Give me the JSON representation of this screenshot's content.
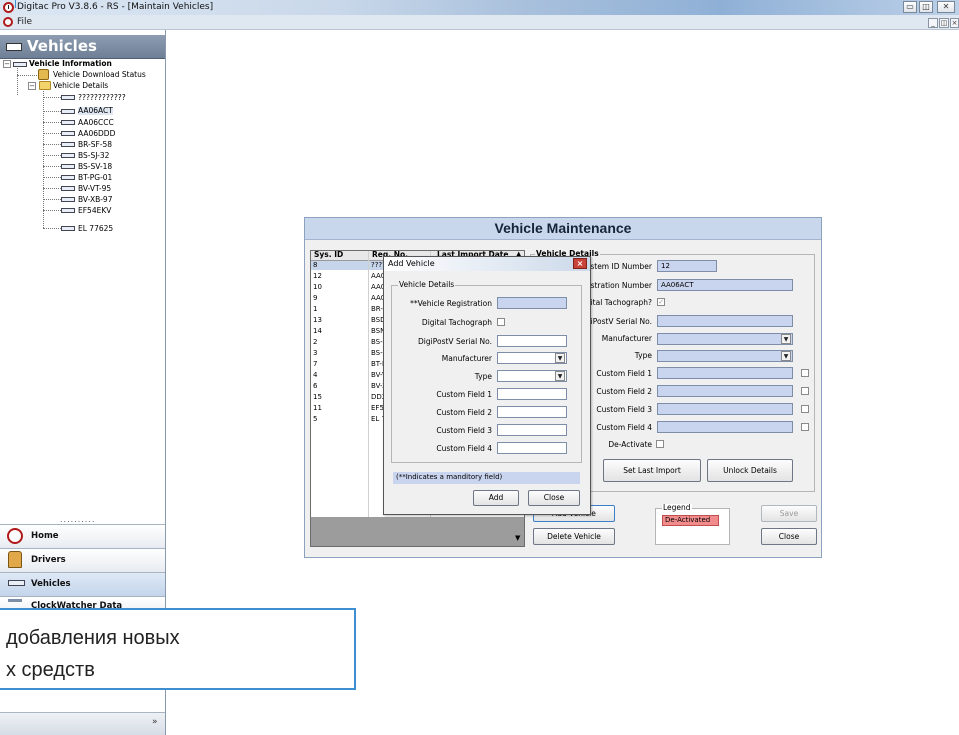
{
  "window": {
    "title": "Digitac Pro V3.8.6 - RS - [Maintain Vehicles]",
    "menu_file": "File"
  },
  "sidebar": {
    "header": "Vehicles",
    "tree": {
      "root": "Vehicle Information",
      "download_status": "Vehicle Download Status",
      "details": "Vehicle Details",
      "vehicles": [
        "????????????",
        "AA06ACT",
        "AA06CCC",
        "AA06DDD",
        "BR-SF-58",
        "BS-SJ-32",
        "BS-SV-18",
        "BT-PG-01",
        "BV-VT-95",
        "BV-XB-97",
        "EF54EKV",
        "EL 77625"
      ]
    },
    "splitter": "..........",
    "nav": [
      {
        "label": "Home",
        "icon": "clock-icon"
      },
      {
        "label": "Drivers",
        "icon": "driver-icon"
      },
      {
        "label": "Vehicles",
        "icon": "vehicle-icon"
      },
      {
        "label": "ClockWatcher Data",
        "icon": "clockwatcher-icon"
      }
    ],
    "more": "»"
  },
  "vm": {
    "title": "Vehicle Maintenance",
    "grid": {
      "columns": [
        "Sys. ID",
        "Reg. No.",
        "Last Import Date"
      ],
      "rows": [
        {
          "id": "8",
          "reg": "????"
        },
        {
          "id": "12",
          "reg": "AA06"
        },
        {
          "id": "10",
          "reg": "AA06"
        },
        {
          "id": "9",
          "reg": "AA06"
        },
        {
          "id": "1",
          "reg": "BR-SF"
        },
        {
          "id": "13",
          "reg": "BSDL"
        },
        {
          "id": "14",
          "reg": "BSNH"
        },
        {
          "id": "2",
          "reg": "BS-SJ"
        },
        {
          "id": "3",
          "reg": "BS-SV"
        },
        {
          "id": "7",
          "reg": "BT-PC"
        },
        {
          "id": "4",
          "reg": "BV-VT"
        },
        {
          "id": "6",
          "reg": "BV-XE"
        },
        {
          "id": "15",
          "reg": "DD20"
        },
        {
          "id": "11",
          "reg": "EF54E"
        },
        {
          "id": "5",
          "reg": "EL 77"
        }
      ]
    },
    "details": {
      "group_label": "Vehicle Details",
      "system_id_label": "System ID Number",
      "system_id_value": "12",
      "reg_label": "Registration Number",
      "reg_value": "AA06ACT",
      "digital_tacho_label": "Digital Tachograph?",
      "serial_label": "DigiPostV Serial No.",
      "manufacturer_label": "Manufacturer",
      "type_label": "Type",
      "custom1": "Custom Field 1",
      "custom2": "Custom Field 2",
      "custom3": "Custom Field 3",
      "custom4": "Custom Field 4",
      "deactivate_label": "De-Activate",
      "set_last_import": "Set Last Import",
      "unlock_details": "Unlock Details"
    },
    "legend": {
      "title": "Legend",
      "deactivated": "De-Activated"
    },
    "buttons": {
      "add_vehicle": "Add Vehicle",
      "delete_vehicle": "Delete Vehicle",
      "save": "Save",
      "close": "Close"
    },
    "colors": {
      "field": "#c9d4ee",
      "deactivated": "#f28b8b",
      "title_bg": "#c9d7ec"
    }
  },
  "dialog": {
    "title": "Add Vehicle",
    "group_label": "Vehicle Details",
    "reg_label": "**Vehicle Registration",
    "digital_label": "Digital Tachograph",
    "serial_label": "DigiPostV Serial No.",
    "manufacturer_label": "Manufacturer",
    "type_label": "Type",
    "custom1": "Custom Field 1",
    "custom2": "Custom Field 2",
    "custom3": "Custom Field 3",
    "custom4": "Custom Field 4",
    "note": "(**Indicates a manditory field)",
    "add": "Add",
    "close": "Close"
  },
  "callout": {
    "line1": "добавления новых",
    "line2": "х средств"
  }
}
